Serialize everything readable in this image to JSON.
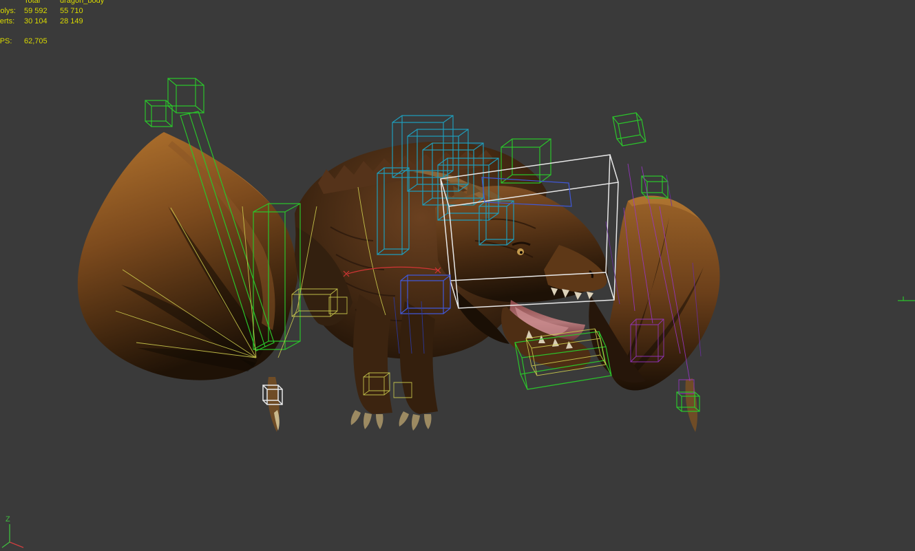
{
  "window": {
    "background_color": "#3a3a3a"
  },
  "stats_overlay": {
    "text_color": "#d9d900",
    "header": {
      "total_label": "Total",
      "selection_label": "dragon_body"
    },
    "rows": [
      {
        "label": "Polys:",
        "total": "59 592",
        "selection": "55 710"
      },
      {
        "label": "Verts:",
        "total": "30 104",
        "selection": "28 149"
      }
    ],
    "fps": {
      "label": "FPS:",
      "value": "62,705"
    }
  },
  "viewport": {
    "scene_object_name": "dragon_body",
    "axis_gizmo": {
      "z_label": "Z"
    },
    "colors": {
      "green": "#2bc42b",
      "teal": "#1f9cba",
      "white": "#e8e8e8",
      "blue": "#4058d8",
      "darkblue": "#2a3aa8",
      "yellow": "#cfcf4f",
      "purple": "#9a35c8",
      "darkpurple": "#6a2ea0",
      "red": "#d23535",
      "axis_green": "#3fbf3f",
      "axis_red": "#cf3f3f"
    }
  }
}
